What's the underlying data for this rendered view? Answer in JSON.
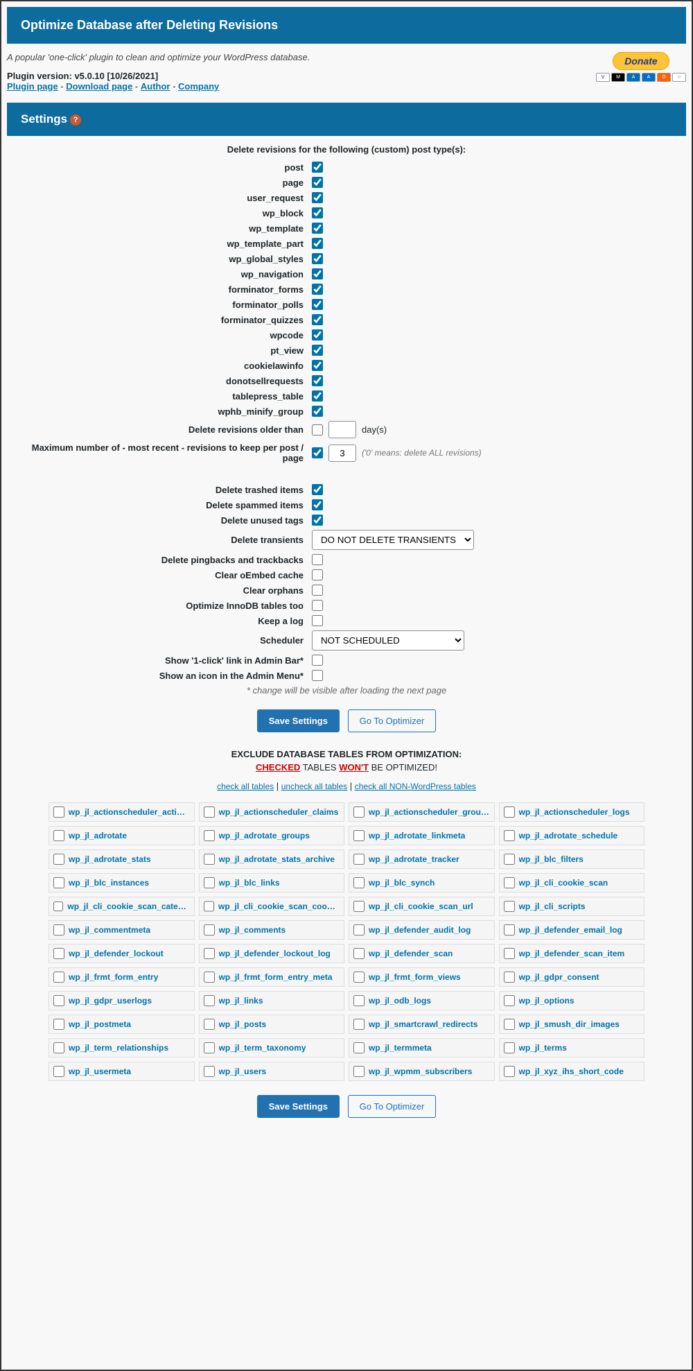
{
  "header": {
    "title": "Optimize Database after Deleting Revisions"
  },
  "intro": {
    "tagline": "A popular 'one-click' plugin to clean and optimize your WordPress database.",
    "version": "Plugin version: v5.0.10 [10/26/2021]",
    "links": {
      "plugin_page": "Plugin page",
      "download_page": "Download page",
      "author": "Author",
      "company": "Company"
    },
    "sep": " - ",
    "donate": "Donate"
  },
  "settings": {
    "title": "Settings"
  },
  "post_types": {
    "heading": "Delete revisions for the following (custom) post type(s):",
    "items": [
      {
        "label": "post",
        "checked": true
      },
      {
        "label": "page",
        "checked": true
      },
      {
        "label": "user_request",
        "checked": true
      },
      {
        "label": "wp_block",
        "checked": true
      },
      {
        "label": "wp_template",
        "checked": true
      },
      {
        "label": "wp_template_part",
        "checked": true
      },
      {
        "label": "wp_global_styles",
        "checked": true
      },
      {
        "label": "wp_navigation",
        "checked": true
      },
      {
        "label": "forminator_forms",
        "checked": true
      },
      {
        "label": "forminator_polls",
        "checked": true
      },
      {
        "label": "forminator_quizzes",
        "checked": true
      },
      {
        "label": "wpcode",
        "checked": true
      },
      {
        "label": "pt_view",
        "checked": true
      },
      {
        "label": "cookielawinfo",
        "checked": true
      },
      {
        "label": "donotsellrequests",
        "checked": true
      },
      {
        "label": "tablepress_table",
        "checked": true
      },
      {
        "label": "wphb_minify_group",
        "checked": true
      }
    ]
  },
  "controls": {
    "older_than": {
      "label": "Delete revisions older than",
      "checked": false,
      "value": "",
      "suffix": "day(s)"
    },
    "max_keep": {
      "label": "Maximum number of - most recent - revisions to keep per post / page",
      "checked": true,
      "value": "3",
      "hint": "('0' means: delete ALL revisions)"
    },
    "trashed": {
      "label": "Delete trashed items",
      "checked": true
    },
    "spammed": {
      "label": "Delete spammed items",
      "checked": true
    },
    "unused_tags": {
      "label": "Delete unused tags",
      "checked": true
    },
    "transients": {
      "label": "Delete transients",
      "selected": "DO NOT DELETE TRANSIENTS"
    },
    "pingbacks": {
      "label": "Delete pingbacks and trackbacks",
      "checked": false
    },
    "oembed": {
      "label": "Clear oEmbed cache",
      "checked": false
    },
    "orphans": {
      "label": "Clear orphans",
      "checked": false
    },
    "innodb": {
      "label": "Optimize InnoDB tables too",
      "checked": false
    },
    "keep_log": {
      "label": "Keep a log",
      "checked": false
    },
    "scheduler": {
      "label": "Scheduler",
      "selected": "NOT SCHEDULED"
    },
    "one_click": {
      "label": "Show '1-click' link in Admin Bar*",
      "checked": false
    },
    "icon": {
      "label": "Show an icon in the Admin Menu*",
      "checked": false
    },
    "note": "* change will be visible after loading the next page"
  },
  "buttons": {
    "save": "Save Settings",
    "optimizer": "Go To Optimizer"
  },
  "exclude": {
    "heading": "EXCLUDE DATABASE TABLES FROM OPTIMIZATION:",
    "sub_checked": "CHECKED",
    "sub_mid": " TABLES ",
    "sub_wont": "WON'T",
    "sub_end": " BE OPTIMIZED!",
    "check_all": "check all tables",
    "uncheck_all": "uncheck all tables",
    "check_nonwp": "check all NON-WordPress tables",
    "sep": " | "
  },
  "tables": [
    "wp_jl_actionscheduler_actions",
    "wp_jl_actionscheduler_claims",
    "wp_jl_actionscheduler_groups",
    "wp_jl_actionscheduler_logs",
    "wp_jl_adrotate",
    "wp_jl_adrotate_groups",
    "wp_jl_adrotate_linkmeta",
    "wp_jl_adrotate_schedule",
    "wp_jl_adrotate_stats",
    "wp_jl_adrotate_stats_archive",
    "wp_jl_adrotate_tracker",
    "wp_jl_blc_filters",
    "wp_jl_blc_instances",
    "wp_jl_blc_links",
    "wp_jl_blc_synch",
    "wp_jl_cli_cookie_scan",
    "wp_jl_cli_cookie_scan_categories",
    "wp_jl_cli_cookie_scan_cookies",
    "wp_jl_cli_cookie_scan_url",
    "wp_jl_cli_scripts",
    "wp_jl_commentmeta",
    "wp_jl_comments",
    "wp_jl_defender_audit_log",
    "wp_jl_defender_email_log",
    "wp_jl_defender_lockout",
    "wp_jl_defender_lockout_log",
    "wp_jl_defender_scan",
    "wp_jl_defender_scan_item",
    "wp_jl_frmt_form_entry",
    "wp_jl_frmt_form_entry_meta",
    "wp_jl_frmt_form_views",
    "wp_jl_gdpr_consent",
    "wp_jl_gdpr_userlogs",
    "wp_jl_links",
    "wp_jl_odb_logs",
    "wp_jl_options",
    "wp_jl_postmeta",
    "wp_jl_posts",
    "wp_jl_smartcrawl_redirects",
    "wp_jl_smush_dir_images",
    "wp_jl_term_relationships",
    "wp_jl_term_taxonomy",
    "wp_jl_termmeta",
    "wp_jl_terms",
    "wp_jl_usermeta",
    "wp_jl_users",
    "wp_jl_wpmm_subscribers",
    "wp_jl_xyz_ihs_short_code"
  ]
}
